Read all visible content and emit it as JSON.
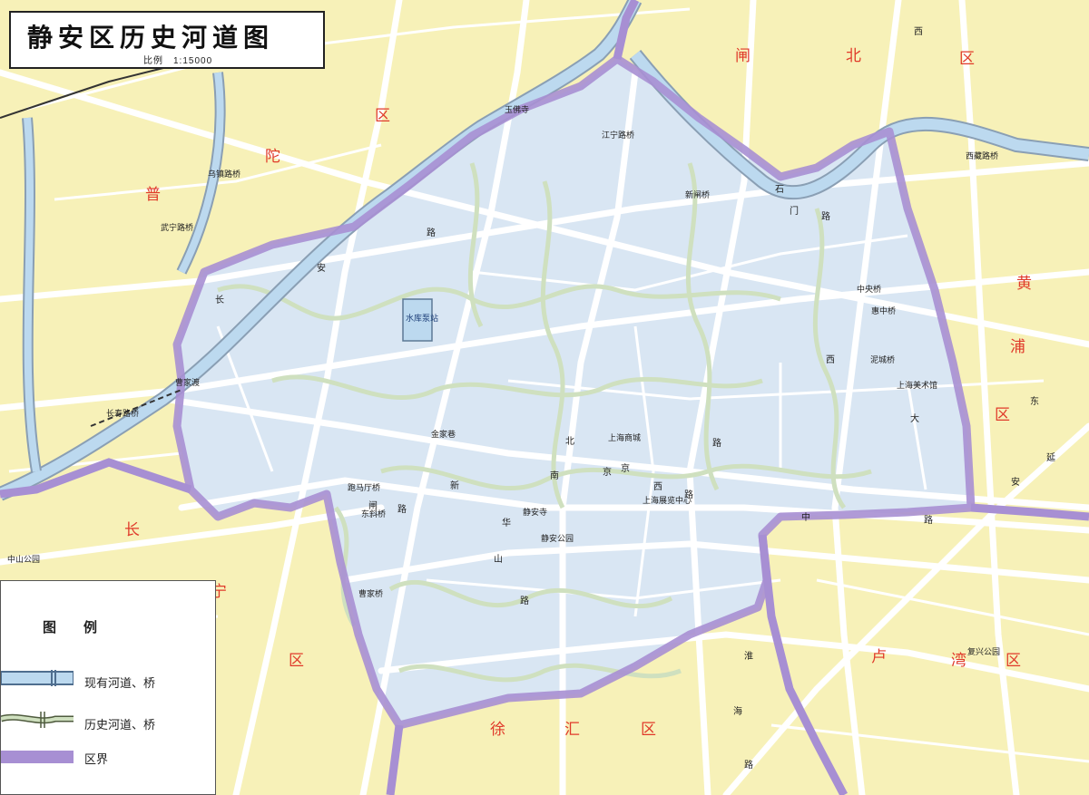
{
  "map": {
    "title": "静安区历史河道图",
    "scale": "比例　1:15000",
    "legend": {
      "title": "图　　例",
      "items": [
        {
          "label": "现有河道、桥",
          "symbol": "existing-river"
        },
        {
          "label": "历史河道、桥",
          "symbol": "historic-river"
        },
        {
          "label": "区界",
          "symbol": "district-boundary"
        }
      ]
    },
    "colors": {
      "background": "#f7f1b8",
      "district_fill": "#d9e6f3",
      "roads": "#ffffff",
      "road_edge": "#666666",
      "existing_river": "#bcd9ef",
      "historic_river": "#cfe0bf",
      "boundary": "#a78fd3",
      "district_labels": "#e03a2a"
    },
    "districts": [
      "普",
      "陀",
      "区",
      "闸",
      "北",
      "区",
      "黄",
      "浦",
      "区",
      "长",
      "宁",
      "区",
      "徐",
      "汇",
      "区",
      "卢",
      "湾",
      "区"
    ],
    "places": [
      "玉佛寺",
      "水库泵站",
      "曹家渡",
      "金家巷",
      "静安寺",
      "静安公园",
      "上海商城",
      "上海展览中心",
      "上海美术馆",
      "复兴公园",
      "中山公园",
      "武宁路桥",
      "长寿路桥",
      "江宁路桥",
      "西藏路桥",
      "乌镇路桥",
      "新闸桥",
      "泥城桥",
      "中央桥",
      "惠中桥",
      "跑马厅桥",
      "东斜桥",
      "曹家桥"
    ],
    "roads": [
      "北",
      "京",
      "西",
      "路",
      "延",
      "安",
      "中",
      "路",
      "华",
      "山",
      "路",
      "南",
      "京",
      "西",
      "路",
      "新",
      "闸",
      "路",
      "长",
      "安",
      "路",
      "淮",
      "海",
      "路",
      "东",
      "大",
      "西",
      "石",
      "门",
      "路"
    ]
  }
}
